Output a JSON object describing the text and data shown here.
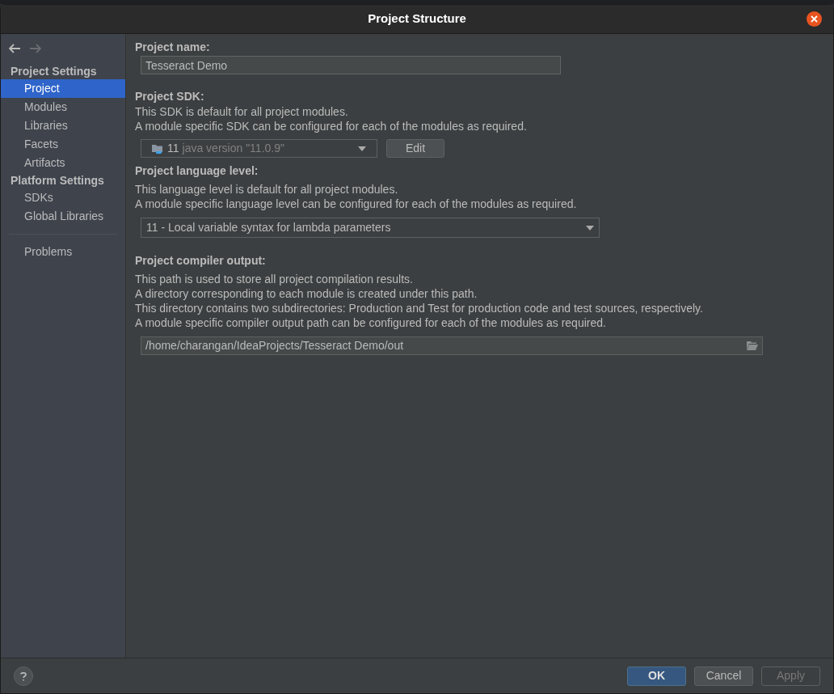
{
  "window": {
    "title": "Project Structure"
  },
  "nav": {
    "back": {
      "disabled": false
    },
    "forward": {
      "disabled": true
    }
  },
  "sidebar": {
    "groups": [
      {
        "heading": "Project Settings",
        "items": [
          {
            "label": "Project",
            "selected": true
          },
          {
            "label": "Modules",
            "selected": false
          },
          {
            "label": "Libraries",
            "selected": false
          },
          {
            "label": "Facets",
            "selected": false
          },
          {
            "label": "Artifacts",
            "selected": false
          }
        ]
      },
      {
        "heading": "Platform Settings",
        "items": [
          {
            "label": "SDKs",
            "selected": false
          },
          {
            "label": "Global Libraries",
            "selected": false
          }
        ]
      }
    ],
    "extra_items": [
      {
        "label": "Problems",
        "selected": false
      }
    ]
  },
  "project_name": {
    "label": "Project name:",
    "value": "Tesseract Demo"
  },
  "project_sdk": {
    "label": "Project SDK:",
    "description": [
      "This SDK is default for all project modules.",
      "A module specific SDK can be configured for each of the modules as required."
    ],
    "sdk_version": "11",
    "sdk_detail": "java version \"11.0.9\"",
    "edit_button": "Edit"
  },
  "language_level": {
    "label": "Project language level:",
    "description": [
      "This language level is default for all project modules.",
      "A module specific language level can be configured for each of the modules as required."
    ],
    "value": "11 - Local variable syntax for lambda parameters"
  },
  "compiler_output": {
    "label": "Project compiler output:",
    "description": [
      "This path is used to store all project compilation results.",
      "A directory corresponding to each module is created under this path.",
      "This directory contains two subdirectories: Production and Test for production code and test sources, respectively.",
      "A module specific compiler output path can be configured for each of the modules as required."
    ],
    "value": "/home/charangan/IdeaProjects/Tesseract Demo/out"
  },
  "footer": {
    "buttons": [
      {
        "label": "OK",
        "kind": "primary",
        "disabled": false
      },
      {
        "label": "Cancel",
        "kind": "normal",
        "disabled": false
      },
      {
        "label": "Apply",
        "kind": "normal",
        "disabled": true
      }
    ]
  }
}
